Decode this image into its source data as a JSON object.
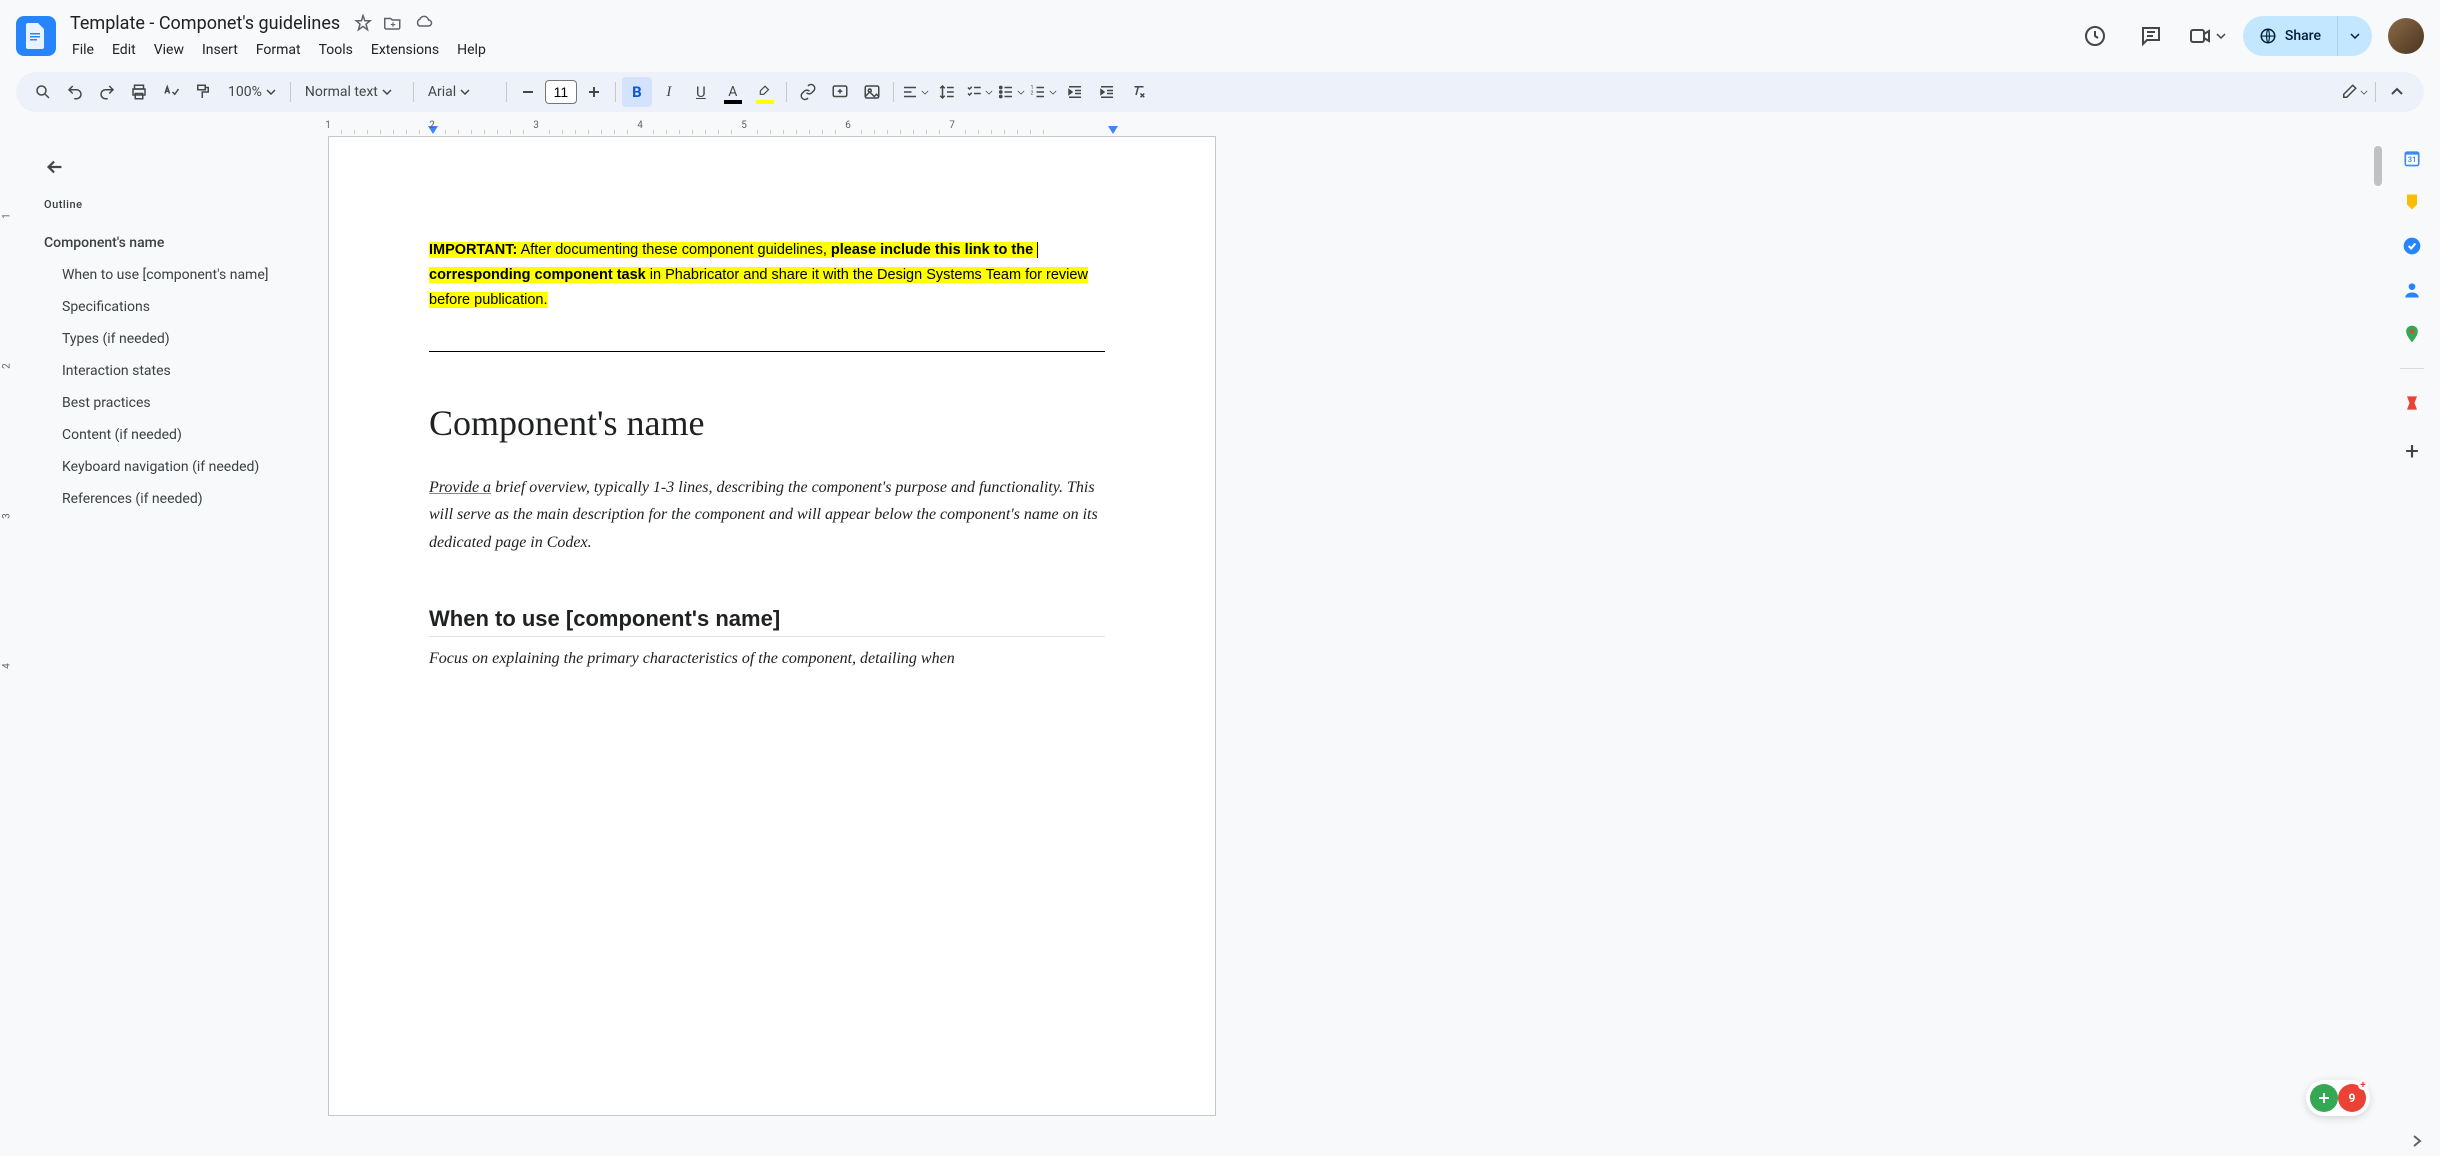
{
  "doc_title": "Template - Componet's guidelines",
  "menus": [
    "File",
    "Edit",
    "View",
    "Insert",
    "Format",
    "Tools",
    "Extensions",
    "Help"
  ],
  "share_label": "Share",
  "toolbar": {
    "zoom": "100%",
    "style": "Normal text",
    "font": "Arial",
    "font_size": "11"
  },
  "ruler_numbers": [
    "1",
    "2",
    "3",
    "4",
    "5",
    "6",
    "7"
  ],
  "ruler_v_numbers": [
    "1",
    "2",
    "3",
    "4"
  ],
  "outline": {
    "title": "Outline",
    "items": [
      {
        "level": "h1",
        "text": "Component's name"
      },
      {
        "level": "h2",
        "text": "When to use [component's name]"
      },
      {
        "level": "h2",
        "text": "Specifications"
      },
      {
        "level": "h2",
        "text": "Types (if needed)"
      },
      {
        "level": "h2",
        "text": "Interaction states"
      },
      {
        "level": "h2",
        "text": "Best practices"
      },
      {
        "level": "h2",
        "text": "Content (if needed)"
      },
      {
        "level": "h2",
        "text": "Keyboard navigation (if needed)"
      },
      {
        "level": "h2",
        "text": "References (if needed)"
      }
    ]
  },
  "page": {
    "important_label": "IMPORTANT:",
    "important_1": " After documenting these component guidelines, ",
    "important_bold": "please include this link to the ",
    "important_bold2": "corresponding component task",
    "important_2": " in Phabricator and share it with the Design Systems Team for review before publication.",
    "h1": "Component's name",
    "intro_underline": "Provide a",
    "intro_rest": " brief overview, typically 1-3 lines, describing the component's purpose and functionality. This will serve as the main description for the component and will appear below the component's name on its dedicated page in Codex.",
    "h2": "When to use [component's name]",
    "body": "Focus on explaining the primary characteristics of the component, detailing when"
  },
  "badge_count": "9"
}
